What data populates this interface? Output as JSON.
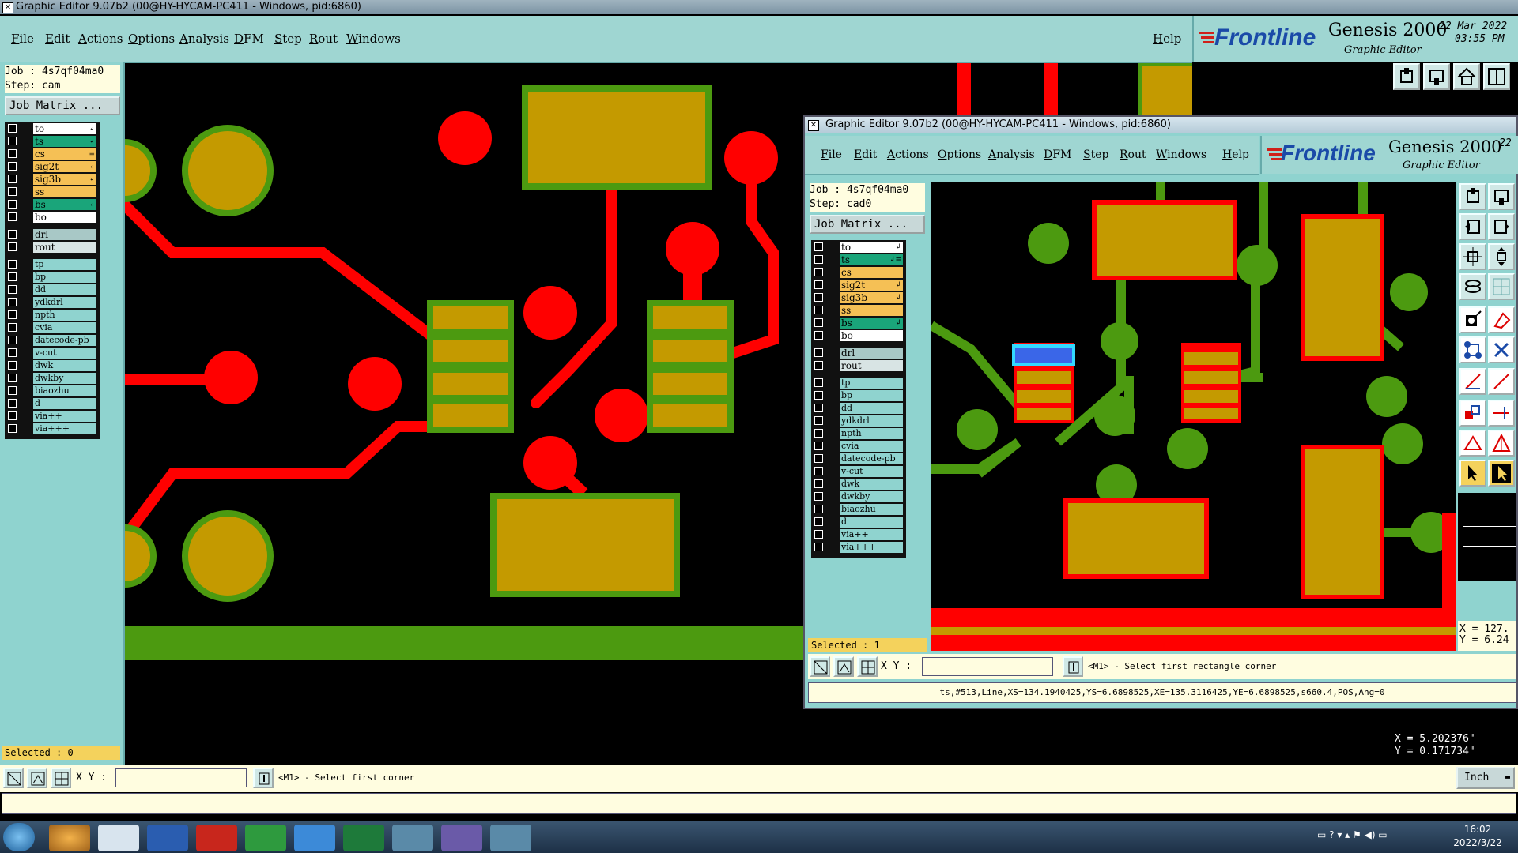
{
  "main_window": {
    "title": "Graphic Editor 9.07b2 (00@HY-HYCAM-PC411 - Windows, pid:6860)",
    "menu": [
      "File",
      "Edit",
      "Actions",
      "Options",
      "Analysis",
      "DFM",
      "Step",
      "Rout",
      "Windows"
    ],
    "help": "Help",
    "brand": "Frontline",
    "product": "Genesis 2000",
    "subtitle": "Graphic Editor",
    "date": "22 Mar 2022",
    "time": "03:55 PM",
    "job": "Job : 4s7qf04ma0",
    "step": "Step: cam",
    "job_matrix": "Job Matrix ...",
    "layers_group1": [
      {
        "name": "to",
        "color": "#ffffff",
        "mark": "↲"
      },
      {
        "name": "ts",
        "color": "#1aa57a",
        "mark": "↲"
      },
      {
        "name": "cs",
        "color": "#f5c055",
        "mark": "≡"
      },
      {
        "name": "sig2t",
        "color": "#f5c055",
        "mark": "↲"
      },
      {
        "name": "sig3b",
        "color": "#f5c055",
        "mark": "↲"
      },
      {
        "name": "ss",
        "color": "#f5c055",
        "mark": ""
      },
      {
        "name": "bs",
        "color": "#1aa57a",
        "mark": "↲"
      },
      {
        "name": "bo",
        "color": "#ffffff",
        "mark": ""
      }
    ],
    "layers_group2": [
      "drl",
      "rout"
    ],
    "layers_group3": [
      "tp",
      "bp",
      "dd",
      "ydkdrl",
      "npth",
      "cvia",
      "datecode-pb",
      "v-cut",
      "dwk",
      "dwkby",
      "biaozhu",
      "d",
      "via++",
      "via+++"
    ],
    "selected": "Selected : 0",
    "xy_label": "X Y :",
    "prompt": "<M1> - Select first corner",
    "coord_x": "X = 5.202376\"",
    "coord_y": "Y = 0.171734\"",
    "units": "Inch"
  },
  "sub_window": {
    "title": "Graphic Editor 9.07b2 (00@HY-HYCAM-PC411 - Windows, pid:6860)",
    "menu": [
      "File",
      "Edit",
      "Actions",
      "Options",
      "Analysis",
      "DFM",
      "Step",
      "Rout",
      "Windows"
    ],
    "help": "Help",
    "brand": "Frontline",
    "product": "Genesis 2000",
    "subtitle": "Graphic Editor",
    "date_partial": "22",
    "job": "Job : 4s7qf04ma0",
    "step": "Step: cad0",
    "job_matrix": "Job Matrix ...",
    "layers_group1": [
      {
        "name": "to",
        "color": "#ffffff",
        "mark": "↲"
      },
      {
        "name": "ts",
        "color": "#1aa57a",
        "mark": "↲≡"
      },
      {
        "name": "cs",
        "color": "#f5c055",
        "mark": ""
      },
      {
        "name": "sig2t",
        "color": "#f5c055",
        "mark": "↲"
      },
      {
        "name": "sig3b",
        "color": "#f5c055",
        "mark": "↲"
      },
      {
        "name": "ss",
        "color": "#f5c055",
        "mark": ""
      },
      {
        "name": "bs",
        "color": "#1aa57a",
        "mark": "↲"
      },
      {
        "name": "bo",
        "color": "#ffffff",
        "mark": ""
      }
    ],
    "layers_group2": [
      "drl",
      "rout"
    ],
    "layers_group3": [
      "tp",
      "bp",
      "dd",
      "ydkdrl",
      "npth",
      "cvia",
      "datecode-pb",
      "v-cut",
      "dwk",
      "dwkby",
      "biaozhu",
      "d",
      "via++",
      "via+++"
    ],
    "selected": "Selected : 1",
    "xy_label": "X Y :",
    "prompt": "<M1> - Select first rectangle corner",
    "feature_info": "ts,#513,Line,XS=134.1940425,YS=6.6898525,XE=135.3116425,YE=6.6898525,s660.4,POS,Ang=0",
    "coord_x": "X = 127.",
    "coord_y": "Y = 6.24"
  },
  "taskbar": {
    "time": "16:02",
    "date": "2022/3/22"
  },
  "colors": {
    "copper_red": "#ff0000",
    "pad_gold": "#c49a00",
    "mask_green": "#4c9a10",
    "panel_cyan": "#8fd3cf"
  }
}
